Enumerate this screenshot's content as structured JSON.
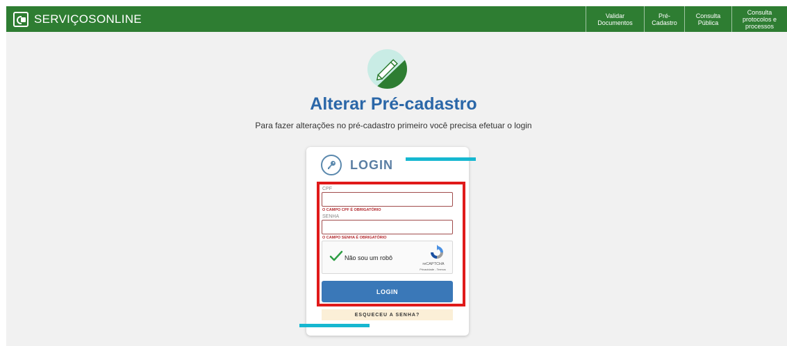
{
  "header": {
    "brand": "SERVIÇOSONLINE",
    "brand_icon": "services-logo-icon",
    "nav": [
      "Validar Documentos",
      "Pré-Cadastro",
      "Consulta Pública",
      "Consulta protocolos e processos"
    ]
  },
  "page": {
    "icon": "edit-pencil-icon",
    "title": "Alterar Pré-cadastro",
    "subtitle": "Para fazer alterações no pré-cadastro primeiro você precisa efetuar o login"
  },
  "login": {
    "title": "LOGIN",
    "icon": "key-icon",
    "cpf_label": "CPF",
    "cpf_value": "",
    "cpf_error": "O CAMPO CPF É OBRIGATÓRIO",
    "senha_label": "SENHA",
    "senha_value": "",
    "senha_error": "O CAMPO SENHA É OBRIGATÓRIO",
    "submit": "LOGIN",
    "forgot": "ESQUECEU A SENHA?"
  },
  "captcha": {
    "text": "Não sou um robô",
    "brand": "reCAPTCHA",
    "links": "Privacidade - Termos",
    "checked": true
  },
  "colors": {
    "header_green": "#2e7d32",
    "title_blue": "#2b67a8",
    "accent_cyan": "#16b7d0",
    "highlight_red": "#e01a1a",
    "button_blue": "#3a78b8"
  }
}
